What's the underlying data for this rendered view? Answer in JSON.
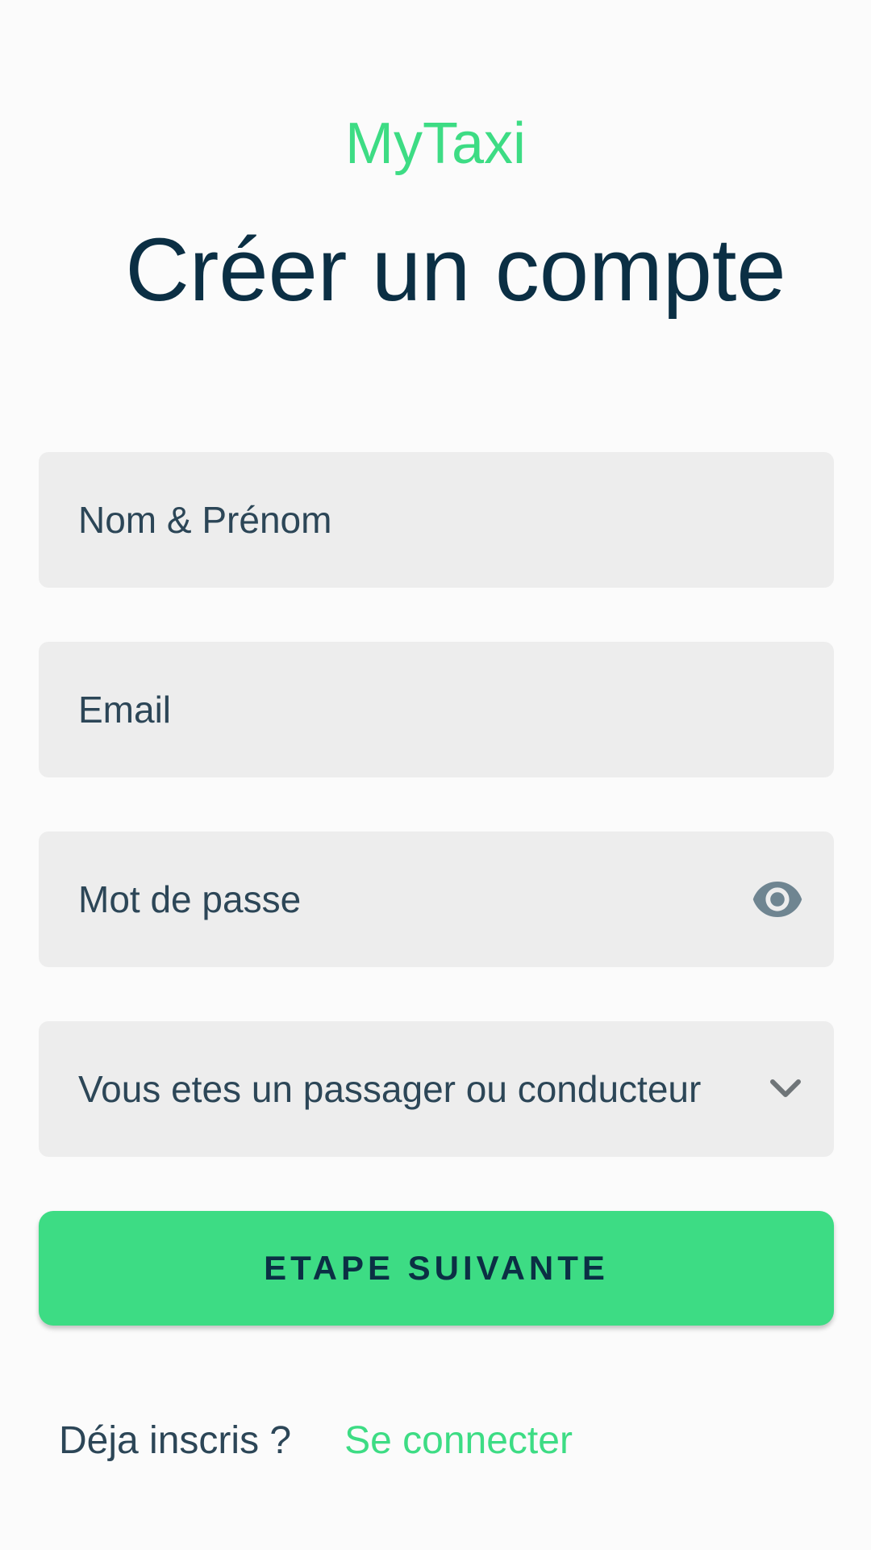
{
  "app": {
    "brand": "MyTaxi",
    "title": "Créer un compte"
  },
  "form": {
    "name_placeholder": "Nom & Prénom",
    "email_placeholder": "Email",
    "password_placeholder": "Mot de passe",
    "role_select_label": "Vous etes un passager ou conducteur"
  },
  "actions": {
    "next_label": "ETAPE SUIVANTE"
  },
  "footer": {
    "question": "Déja inscris ?",
    "login_link": "Se connecter"
  },
  "icons": {
    "password_toggle": "eye-icon",
    "select_arrow": "chevron-down-icon"
  },
  "colors": {
    "accent": "#3ddc84",
    "title": "#0b2f44",
    "field_bg": "#ededed",
    "field_text": "#2c4657"
  }
}
